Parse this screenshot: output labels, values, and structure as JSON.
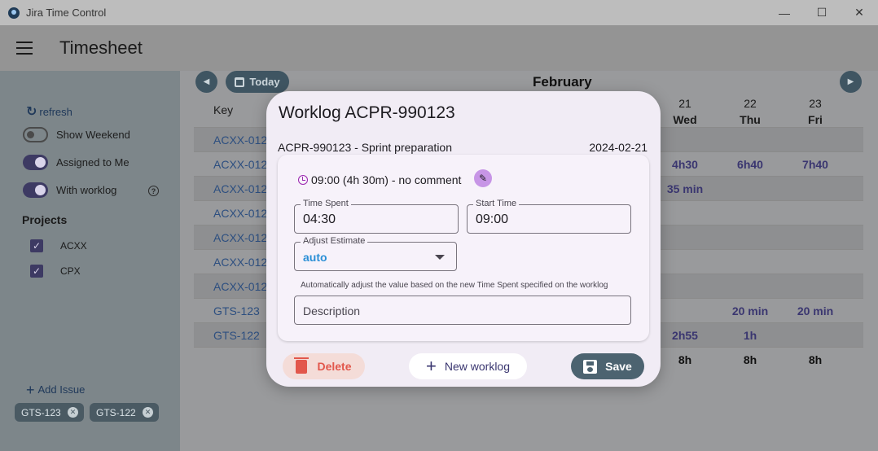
{
  "window": {
    "title": "Jira Time Control",
    "minimize": "—",
    "maximize": "☐",
    "close": "✕"
  },
  "appbar": {
    "title": "Timesheet"
  },
  "sidebar": {
    "refresh": "refresh",
    "toggles": [
      {
        "label": "Show Weekend",
        "on": false
      },
      {
        "label": "Assigned to Me",
        "on": true
      },
      {
        "label": "With worklog",
        "on": true
      }
    ],
    "help": "?",
    "projects_heading": "Projects",
    "projects": [
      {
        "label": "ACXX",
        "checked": true
      },
      {
        "label": "CPX",
        "checked": true
      }
    ],
    "add_issue": "Add Issue",
    "chips": [
      {
        "label": "GTS-123"
      },
      {
        "label": "GTS-122"
      }
    ]
  },
  "calendar": {
    "today": "Today",
    "month": "February",
    "key_header": "Key",
    "days": [
      {
        "num": "21",
        "name": "Wed"
      },
      {
        "num": "22",
        "name": "Thu"
      },
      {
        "num": "23",
        "name": "Fri"
      }
    ],
    "rows": [
      {
        "key": "ACXX-012",
        "cells": [
          "",
          "",
          ""
        ]
      },
      {
        "key": "ACXX-012",
        "cells": [
          "4h30",
          "6h40",
          "7h40"
        ]
      },
      {
        "key": "ACXX-012",
        "cells": [
          "35 min",
          "",
          ""
        ]
      },
      {
        "key": "ACXX-012",
        "cells": [
          "",
          "",
          ""
        ]
      },
      {
        "key": "ACXX-012",
        "cells": [
          "",
          "",
          ""
        ]
      },
      {
        "key": "ACXX-012",
        "cells": [
          "",
          "",
          ""
        ]
      },
      {
        "key": "ACXX-012",
        "cells": [
          "",
          "",
          ""
        ]
      },
      {
        "key": "GTS-123",
        "cells": [
          "",
          "20 min",
          "20 min"
        ]
      },
      {
        "key": "GTS-122",
        "cells": [
          "2h55",
          "1h",
          ""
        ]
      }
    ],
    "totals": [
      "8h",
      "8h",
      "8h"
    ]
  },
  "dialog": {
    "title": "Worklog ACPR-990123",
    "subtitle": "ACPR-990123 - Sprint preparation",
    "date": "2024-02-21",
    "log_line": "09:00 (4h 30m) - no comment",
    "time_spent": {
      "label": "Time Spent",
      "value": "04:30"
    },
    "start_time": {
      "label": "Start Time",
      "value": "09:00"
    },
    "adjust_estimate": {
      "label": "Adjust Estimate",
      "value": "auto"
    },
    "helper": "Automatically adjust the value based on the new Time Spent specified on the worklog",
    "description": {
      "placeholder": "Description"
    },
    "buttons": {
      "delete": "Delete",
      "new": "New worklog",
      "save": "Save"
    }
  }
}
